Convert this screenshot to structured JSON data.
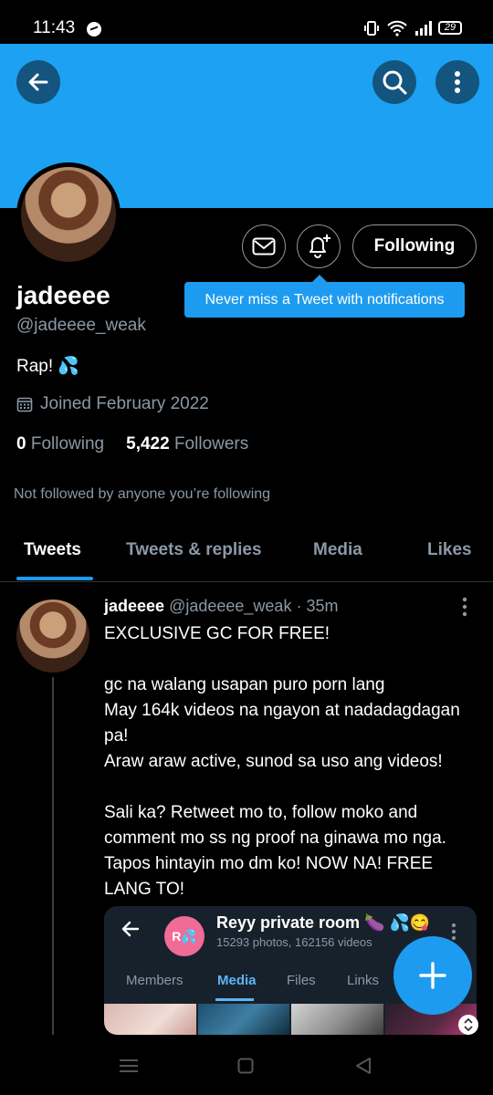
{
  "status_bar": {
    "time": "11:43",
    "battery": "29"
  },
  "profile": {
    "display_name": "jadeeee",
    "handle": "@jadeeee_weak",
    "bio": "Rap! 💦",
    "joined": "Joined February 2022",
    "following_count": "0",
    "following_label": "Following",
    "followers_count": "5,422",
    "followers_label": "Followers",
    "not_followed": "Not followed by anyone you’re following"
  },
  "actions": {
    "following_button": "Following",
    "tooltip": "Never miss a Tweet with notifications"
  },
  "tabs": [
    {
      "label": "Tweets",
      "active": true
    },
    {
      "label": "Tweets & replies"
    },
    {
      "label": "Media"
    },
    {
      "label": "Likes"
    }
  ],
  "tweet": {
    "author_name": "jadeeee",
    "author_handle": "@jadeeee_weak",
    "time": "· 35m",
    "text": "EXCLUSIVE GC FOR FREE!\n\ngc na walang usapan puro porn lang\nMay 164k videos na ngayon at nadadagdagan pa!\nAraw araw active, sunod sa uso ang videos!\n\nSali ka? Retweet mo to, follow moko and comment mo ss ng proof na ginawa mo nga. Tapos hintayin mo dm ko! NOW NA! FREE LANG TO!",
    "media": {
      "avatar_initials": "R💦",
      "title": "Reyy private room 🍆 💦😋",
      "subtitle": "15293 photos, 162156 videos",
      "tabs": [
        "Members",
        "Media",
        "Files",
        "Links"
      ],
      "active_tab": "Media"
    }
  },
  "colors": {
    "banner": "#1da1f2",
    "accent": "#1d9bf0",
    "text_primary": "#ffffff",
    "text_secondary": "#8b98a5"
  }
}
